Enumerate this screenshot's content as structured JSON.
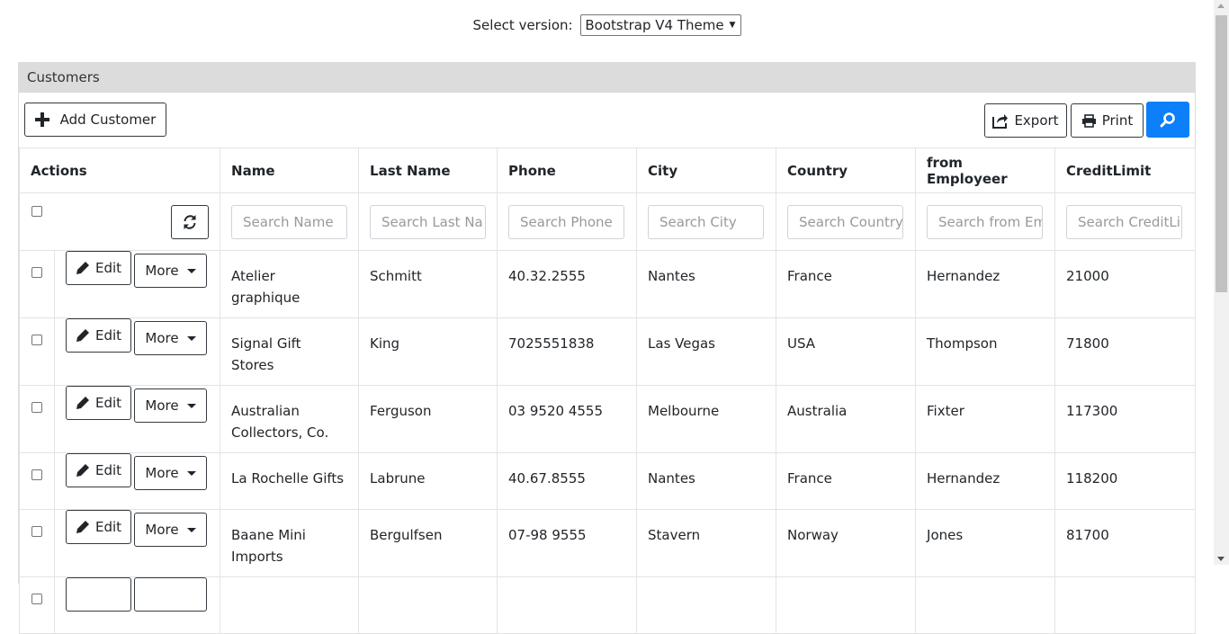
{
  "version": {
    "label": "Select version:",
    "selected": "Bootstrap V4 Theme"
  },
  "panel": {
    "title": "Customers",
    "toolbar": {
      "add_label": "Add Customer",
      "export_label": "Export",
      "print_label": "Print"
    }
  },
  "table": {
    "headers": [
      "Actions",
      "Name",
      "Last Name",
      "Phone",
      "City",
      "Country",
      "from Employeer",
      "CreditLimit"
    ],
    "filters": [
      "Search Name",
      "Search Last Na",
      "Search Phone",
      "Search City",
      "Search Country",
      "Search from Em",
      "Search CreditLi"
    ],
    "row_buttons": {
      "edit": "Edit",
      "more": "More"
    },
    "rows": [
      [
        "Atelier graphique",
        "Schmitt",
        "40.32.2555",
        "Nantes",
        "France",
        "Hernandez",
        "21000"
      ],
      [
        "Signal Gift Stores",
        "King",
        "7025551838",
        "Las Vegas",
        "USA",
        "Thompson",
        "71800"
      ],
      [
        "Australian Collectors, Co.",
        "Ferguson",
        "03 9520 4555",
        "Melbourne",
        "Australia",
        "Fixter",
        "117300"
      ],
      [
        "La Rochelle Gifts",
        "Labrune",
        "40.67.8555",
        "Nantes",
        "France",
        "Hernandez",
        "118200"
      ],
      [
        "Baane Mini Imports",
        "Bergulfsen",
        "07-98 9555",
        "Stavern",
        "Norway",
        "Jones",
        "81700"
      ]
    ]
  },
  "colors": {
    "primary": "#0d7ff8",
    "header_bg": "#dcdcdc",
    "border": "#e3e3e3"
  },
  "icons": {
    "add": "plus-icon",
    "export": "export-icon",
    "print": "printer-icon",
    "search": "search-icon",
    "refresh": "refresh-icon",
    "edit": "pencil-icon",
    "more": "caret-down-icon"
  }
}
